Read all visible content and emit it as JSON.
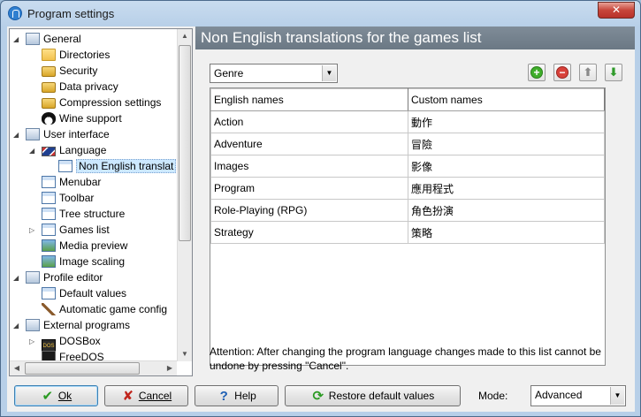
{
  "window": {
    "title": "Program settings",
    "close_label": "✕"
  },
  "tree": {
    "items": [
      {
        "label": "General",
        "icon": "settings-icon"
      },
      {
        "label": "Directories",
        "icon": "folder-icon"
      },
      {
        "label": "Security",
        "icon": "lock-icon"
      },
      {
        "label": "Data privacy",
        "icon": "lock-icon"
      },
      {
        "label": "Compression settings",
        "icon": "lock-icon"
      },
      {
        "label": "Wine support",
        "icon": "penguin-icon"
      },
      {
        "label": "User interface",
        "icon": "settings-icon"
      },
      {
        "label": "Language",
        "icon": "flag-icon"
      },
      {
        "label": "Non English translat",
        "icon": "window-icon",
        "selected": true
      },
      {
        "label": "Menubar",
        "icon": "window-icon"
      },
      {
        "label": "Toolbar",
        "icon": "window-icon"
      },
      {
        "label": "Tree structure",
        "icon": "window-icon"
      },
      {
        "label": "Games list",
        "icon": "window-icon"
      },
      {
        "label": "Media preview",
        "icon": "image-icon"
      },
      {
        "label": "Image scaling",
        "icon": "image-icon"
      },
      {
        "label": "Profile editor",
        "icon": "settings-icon"
      },
      {
        "label": "Default values",
        "icon": "window-icon"
      },
      {
        "label": "Automatic game config",
        "icon": "wand-icon"
      },
      {
        "label": "External programs",
        "icon": "settings-icon"
      },
      {
        "label": "DOSBox",
        "icon": "dosbox-icon"
      },
      {
        "label": "FreeDOS",
        "icon": "freedos-icon"
      }
    ]
  },
  "panel": {
    "title": "Non English translations for the games list",
    "category_select": "Genre",
    "columns": [
      "English names",
      "Custom names"
    ],
    "rows": [
      [
        "Action",
        "動作"
      ],
      [
        "Adventure",
        "冒險"
      ],
      [
        "Images",
        "影像"
      ],
      [
        "Program",
        "應用程式"
      ],
      [
        "Role-Playing (RPG)",
        "角色扮演"
      ],
      [
        "Strategy",
        "策略"
      ]
    ],
    "attention": "Attention: After changing the program language changes made to this list cannot be undone by pressing \"Cancel\"."
  },
  "buttons": {
    "ok": "Ok",
    "cancel": "Cancel",
    "help": "Help",
    "restore": "Restore default values",
    "mode_label": "Mode:",
    "mode_value": "Advanced"
  },
  "colors": {
    "header_bar": "#74818d",
    "add_green": "#3fae2a",
    "delete_red": "#d8413a",
    "selection": "#cce8ff"
  }
}
